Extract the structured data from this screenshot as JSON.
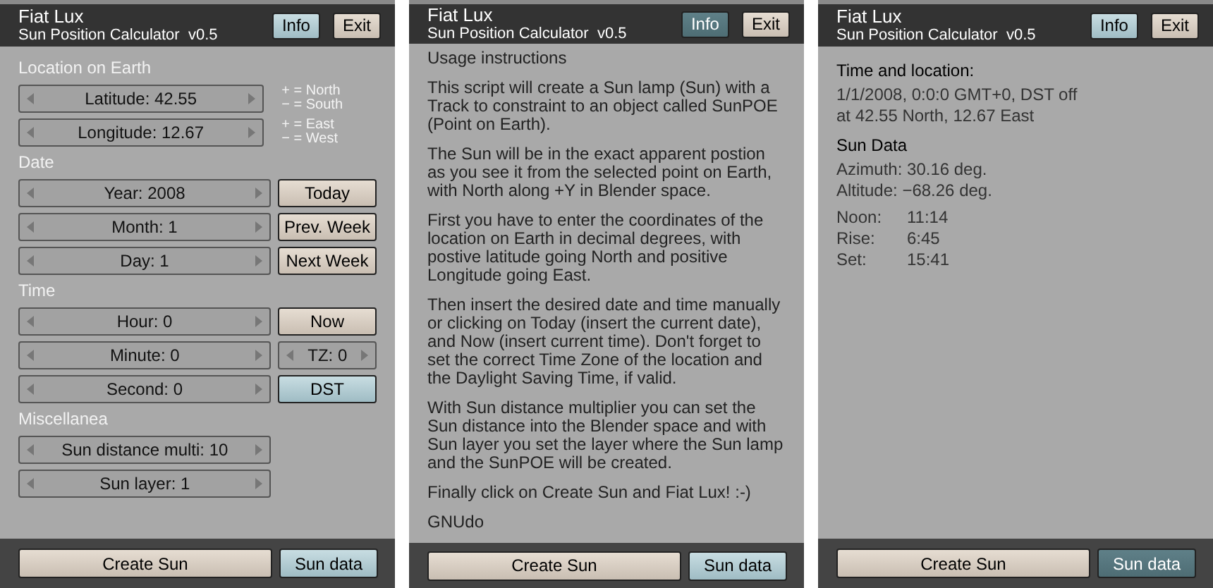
{
  "panels": [
    {
      "header": {
        "title": "Fiat Lux",
        "subtitle": "Sun Position Calculator  v0.5",
        "buttons": [
          {
            "label": "Info",
            "kind": "toggle",
            "selected": false
          },
          {
            "label": "Exit",
            "kind": "push"
          }
        ]
      },
      "body": {
        "kind": "controls",
        "sections": [
          {
            "heading": "Location on Earth",
            "rows": [
              {
                "field": "Latitude: 42.55",
                "side": {
                  "kind": "hint",
                  "lines": [
                    "+ = North",
                    "− = South"
                  ]
                }
              },
              {
                "field": "Longitude: 12.67",
                "side": {
                  "kind": "hint",
                  "lines": [
                    "+ = East",
                    "− = West"
                  ]
                }
              }
            ]
          },
          {
            "heading": "Date",
            "rows": [
              {
                "field": "Year: 2008",
                "side": {
                  "kind": "push",
                  "label": "Today"
                }
              },
              {
                "field": "Month: 1",
                "side": {
                  "kind": "push",
                  "label": "Prev. Week"
                }
              },
              {
                "field": "Day: 1",
                "side": {
                  "kind": "push",
                  "label": "Next Week"
                }
              }
            ]
          },
          {
            "heading": "Time",
            "rows": [
              {
                "field": "Hour: 0",
                "side": {
                  "kind": "push",
                  "label": "Now"
                }
              },
              {
                "field": "Minute: 0",
                "side": {
                  "kind": "number",
                  "label": "TZ: 0"
                }
              },
              {
                "field": "Second: 0",
                "side": {
                  "kind": "toggle",
                  "label": "DST",
                  "selected": false
                }
              }
            ]
          },
          {
            "heading": "Miscellanea",
            "rows": [
              {
                "field": "Sun distance multi: 10"
              },
              {
                "field": "Sun layer: 1"
              }
            ]
          }
        ]
      },
      "footer": {
        "buttons": [
          {
            "label": "Create Sun",
            "kind": "push"
          },
          {
            "label": "Sun data",
            "kind": "toggle",
            "selected": false
          }
        ]
      }
    },
    {
      "header": {
        "title": "Fiat Lux",
        "subtitle": "Sun Position Calculator  v0.5",
        "buttons": [
          {
            "label": "Info",
            "kind": "toggle",
            "selected": true
          },
          {
            "label": "Exit",
            "kind": "push"
          }
        ]
      },
      "body": {
        "kind": "instructions",
        "paragraphs": [
          "Usage instructions",
          "This script will create a Sun lamp (Sun) with a Track to constraint to an object called SunPOE (Point on Earth).",
          "The Sun will be in the exact apparent postion as you see it from the selected point on Earth, with North along +Y in Blender space.",
          "First you have to enter the coordinates of the location on Earth in decimal degrees, with postive latitude going North and positive Longitude going East.",
          "Then insert the desired date and time manually or clicking on Today (insert the current date), and Now (insert current time). Don't forget to set the correct Time Zone of the location and the Daylight Saving Time, if valid.",
          "With Sun distance multiplier you can set the Sun distance into the Blender space and with Sun layer you set the layer where the Sun lamp and the SunPOE will be created.",
          "Finally click on Create Sun and Fiat Lux! :-)",
          "GNUdo"
        ]
      },
      "footer": {
        "buttons": [
          {
            "label": "Create Sun",
            "kind": "push"
          },
          {
            "label": "Sun data",
            "kind": "toggle",
            "selected": false
          }
        ]
      }
    },
    {
      "header": {
        "title": "Fiat Lux",
        "subtitle": "Sun Position Calculator  v0.5",
        "buttons": [
          {
            "label": "Info",
            "kind": "toggle",
            "selected": false
          },
          {
            "label": "Exit",
            "kind": "push"
          }
        ]
      },
      "body": {
        "kind": "sun_data",
        "groups": [
          {
            "heading": "Time and location:",
            "lines": [
              "1/1/2008, 0:0:0 GMT+0, DST off",
              "at 42.55 North, 12.67 East"
            ]
          },
          {
            "heading": "Sun Data",
            "lines": [
              "Azimuth: 30.16 deg.",
              "Altitude: −68.26 deg."
            ],
            "table": [
              {
                "label": "Noon:",
                "value": "11:14"
              },
              {
                "label": "Rise:",
                "value": "6:45"
              },
              {
                "label": "Set:",
                "value": "15:41"
              }
            ]
          }
        ]
      },
      "footer": {
        "buttons": [
          {
            "label": "Create Sun",
            "kind": "push"
          },
          {
            "label": "Sun data",
            "kind": "toggle",
            "selected": true
          }
        ]
      }
    }
  ]
}
